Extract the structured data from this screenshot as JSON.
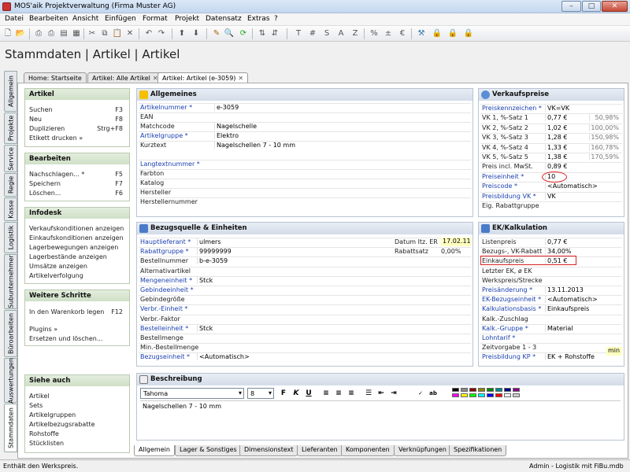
{
  "window": {
    "title": "MOS'aik Projektverwaltung (Firma Muster AG)",
    "min": "–",
    "max": "□",
    "close": "✕"
  },
  "menu": [
    "Datei",
    "Bearbeiten",
    "Ansicht",
    "Einfügen",
    "Format",
    "Projekt",
    "Datensatz",
    "Extras",
    "?"
  ],
  "page_title": "Stammdaten | Artikel | Artikel",
  "vtabs": [
    "Allgemein",
    "Projekte",
    "Service",
    "Regie",
    "Kasse",
    "Logistik",
    "Subunternehmer",
    "Büroarbeiten",
    "Auswertungen",
    "Stammdaten"
  ],
  "doc_tabs": [
    "Home: Startseite",
    "Artikel: Alle Artikel",
    "Artikel: Artikel (e-3059)"
  ],
  "left": {
    "artikel": {
      "title": "Artikel",
      "items": [
        {
          "l": "Suchen",
          "k": "F3"
        },
        {
          "l": "Neu",
          "k": "F8"
        },
        {
          "l": "Duplizieren",
          "k": "Strg+F8"
        },
        {
          "l": "Etikett drucken »",
          "k": ""
        }
      ]
    },
    "bearbeiten": {
      "title": "Bearbeiten",
      "items": [
        {
          "l": "Nachschlagen... *",
          "k": "F5"
        },
        {
          "l": "Speichern",
          "k": "F7"
        },
        {
          "l": "Löschen...",
          "k": "F6"
        }
      ]
    },
    "infodesk": {
      "title": "Infodesk",
      "items": [
        "Verkaufskonditionen anzeigen",
        "Einkaufskonditionen anzeigen",
        "Lagerbewegungen anzeigen",
        "Lagerbestände anzeigen",
        "Umsätze anzeigen",
        "Artikelverfolgung"
      ]
    },
    "weitere": {
      "title": "Weitere Schritte",
      "items": [
        {
          "l": "In den Warenkorb legen",
          "k": "F12"
        },
        {
          "l": "Plugins »",
          "k": ""
        },
        {
          "l": "Ersetzen und löschen...",
          "k": ""
        }
      ]
    },
    "siehe": {
      "title": "Siehe auch",
      "items": [
        "Artikel",
        "Sets",
        "Artikelgruppen",
        "Artikelbezugsrabatte",
        "Rohstoffe",
        "Stücklisten"
      ]
    }
  },
  "allgemeines": {
    "title": "Allgemeines",
    "rows": [
      {
        "l": "Artikelnummer *",
        "v": "e-3059",
        "link": true
      },
      {
        "l": "EAN",
        "v": "",
        "link": false
      },
      {
        "l": "Matchcode",
        "v": "Nagelschelle",
        "link": false
      },
      {
        "l": "Artikelgruppe *",
        "v": "Elektro",
        "link": true
      },
      {
        "l": "Kurztext",
        "v": "Nagelschellen 7 - 10 mm",
        "link": false
      },
      {
        "l": "Langtextnummer *",
        "v": "",
        "link": true
      },
      {
        "l": "Farbton",
        "v": "",
        "link": false
      },
      {
        "l": "Katalog",
        "v": "",
        "link": false
      },
      {
        "l": "Hersteller",
        "v": "",
        "link": false
      },
      {
        "l": "Herstellernummer",
        "v": "",
        "link": false
      }
    ]
  },
  "verkaufspreise": {
    "title": "Verkaufspreise",
    "rows": [
      {
        "l": "Preiskennzeichen *",
        "v": "VK=VK",
        "p": "",
        "link": true
      },
      {
        "l": "VK 1, %-Satz 1",
        "v": "0,77 €",
        "p": "50,98%",
        "link": false
      },
      {
        "l": "VK 2, %-Satz 2",
        "v": "1,02 €",
        "p": "100,00%",
        "link": false
      },
      {
        "l": "VK 3, %-Satz 3",
        "v": "1,28 €",
        "p": "150,98%",
        "link": false
      },
      {
        "l": "VK 4, %-Satz 4",
        "v": "1,33 €",
        "p": "160,78%",
        "link": false
      },
      {
        "l": "VK 5, %-Satz 5",
        "v": "1,38 €",
        "p": "170,59%",
        "link": false
      },
      {
        "l": "Preis incl. MwSt.",
        "v": "0,89 €",
        "p": "",
        "link": false
      },
      {
        "l": "Preiseinheit *",
        "v": "10",
        "p": "",
        "link": true
      },
      {
        "l": "Preiscode *",
        "v": "<Automatisch>",
        "p": "",
        "link": true
      },
      {
        "l": "Preisbildung VK *",
        "v": "VK",
        "p": "",
        "link": true
      },
      {
        "l": "Eig. Rabattgruppe",
        "v": "",
        "p": "",
        "link": false
      }
    ]
  },
  "bezugsquelle": {
    "title": "Bezugsquelle & Einheiten",
    "rows": [
      {
        "l": "Hauptlieferant *",
        "v": "ulmers",
        "link": true
      },
      {
        "l": "Rabattgruppe *",
        "v": "99999999",
        "link": true
      },
      {
        "l": "Bestellnummer",
        "v": "b-e-3059",
        "link": false
      },
      {
        "l": "Alternativartikel",
        "v": "",
        "link": false
      },
      {
        "l": "Mengeneinheit *",
        "v": "Stck",
        "link": true
      },
      {
        "l": "Gebindeeinheit *",
        "v": "",
        "link": true
      },
      {
        "l": "Gebindegröße",
        "v": "",
        "link": false
      },
      {
        "l": "Verbr.-Einheit *",
        "v": "",
        "link": true
      },
      {
        "l": "Verbr.-Faktor",
        "v": "",
        "link": false
      },
      {
        "l": "Bestelleinheit *",
        "v": "Stck",
        "link": true
      },
      {
        "l": "Bestellmenge",
        "v": "",
        "link": false
      },
      {
        "l": "Min.-Bestellmenge",
        "v": "",
        "link": false
      },
      {
        "l": "Bezugseinheit *",
        "v": "<Automatisch>",
        "link": true
      }
    ],
    "datum_label": "Datum ltz. ER",
    "datum": "17.02.11",
    "rabattsatz_label": "Rabattsatz",
    "rabattsatz": "0,00%"
  },
  "ek": {
    "title": "EK/Kalkulation",
    "rows": [
      {
        "l": "Listenpreis",
        "v": "0,77 €",
        "link": false
      },
      {
        "l": "Bezugs-, VK-Rabatt",
        "v": "34,00%",
        "link": false
      },
      {
        "l": "Einkaufspreis",
        "v": "0,51 €",
        "link": false
      },
      {
        "l": "Letzter EK, ø EK",
        "v": "",
        "link": false
      },
      {
        "l": "Werkspreis/Strecke",
        "v": "",
        "link": false
      },
      {
        "l": "Preisänderung *",
        "v": "13.11.2013",
        "link": true
      },
      {
        "l": "EK-Bezugseinheit *",
        "v": "<Automatisch>",
        "link": true
      },
      {
        "l": "Kalkulationsbasis *",
        "v": "Einkaufspreis",
        "link": true
      },
      {
        "l": "Kalk.-Zuschlag",
        "v": "",
        "link": false
      },
      {
        "l": "Kalk.-Gruppe *",
        "v": "Material",
        "link": true
      },
      {
        "l": "Lohntarif *",
        "v": "",
        "link": true
      },
      {
        "l": "Zeitvorgabe 1 - 3",
        "v": "",
        "link": false
      },
      {
        "l": "Preisbildung KP *",
        "v": "EK + Rohstoffe",
        "link": true
      }
    ],
    "min_label": "min"
  },
  "beschreibung": {
    "title": "Beschreibung",
    "font": "Tahoma",
    "size": "8",
    "text": "Nagelschellen 7 - 10 mm"
  },
  "bottom_tabs": [
    "Allgemein",
    "Lager & Sonstiges",
    "Dimensionstext",
    "Lieferanten",
    "Komponenten",
    "Verknüpfungen",
    "Spezifikationen"
  ],
  "status": {
    "left": "Enthält den Werkspreis.",
    "right": "Admin - Logistik mit FiBu.mdb"
  },
  "colors": {
    "link": "#1a3fb0",
    "highlight": "#d22222",
    "panel_green": "#cfe0c7",
    "panel_blue": "#d3dce9"
  }
}
